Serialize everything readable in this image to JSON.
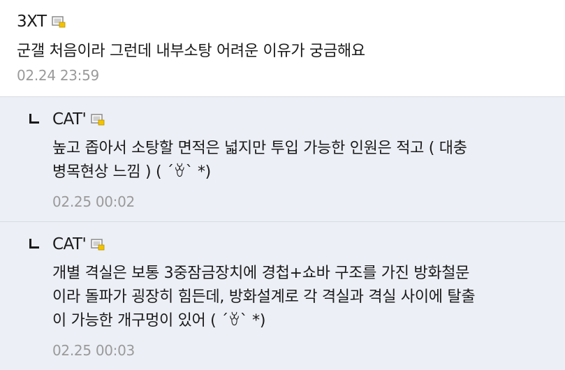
{
  "comments": [
    {
      "author": "3XT",
      "icon": "member-icon",
      "lines": [
        "군갤 처음이라 그런데 내부소탕 어려운 이유가 궁금해요"
      ],
      "timestamp": "02.24 23:59"
    }
  ],
  "replies": [
    {
      "author": "CAT'",
      "icon": "member-icon",
      "lines": [
        "높고 좁아서 소탕할 면적은 넓지만 투입 가능한 인원은 적고 ( 대충",
        "병목현상 느낌 ) ( ´ꈊ` *)"
      ],
      "timestamp": "02.25 00:02"
    },
    {
      "author": "CAT'",
      "icon": "member-icon",
      "lines": [
        "개별 격실은 보통 3중잠금장치에 경첩+쇼바 구조를 가진 방화철문",
        "이라 돌파가 굉장히 힘든데, 방화설계로 각 격실과 격실 사이에 탈출",
        "이 가능한 개구멍이 있어 ( ´ꈊ` *)"
      ],
      "timestamp": "02.25 00:03"
    }
  ],
  "colors": {
    "reply_background": "#eceff5",
    "timestamp": "#9a9a9a",
    "icon_badge": "#f2c300"
  }
}
